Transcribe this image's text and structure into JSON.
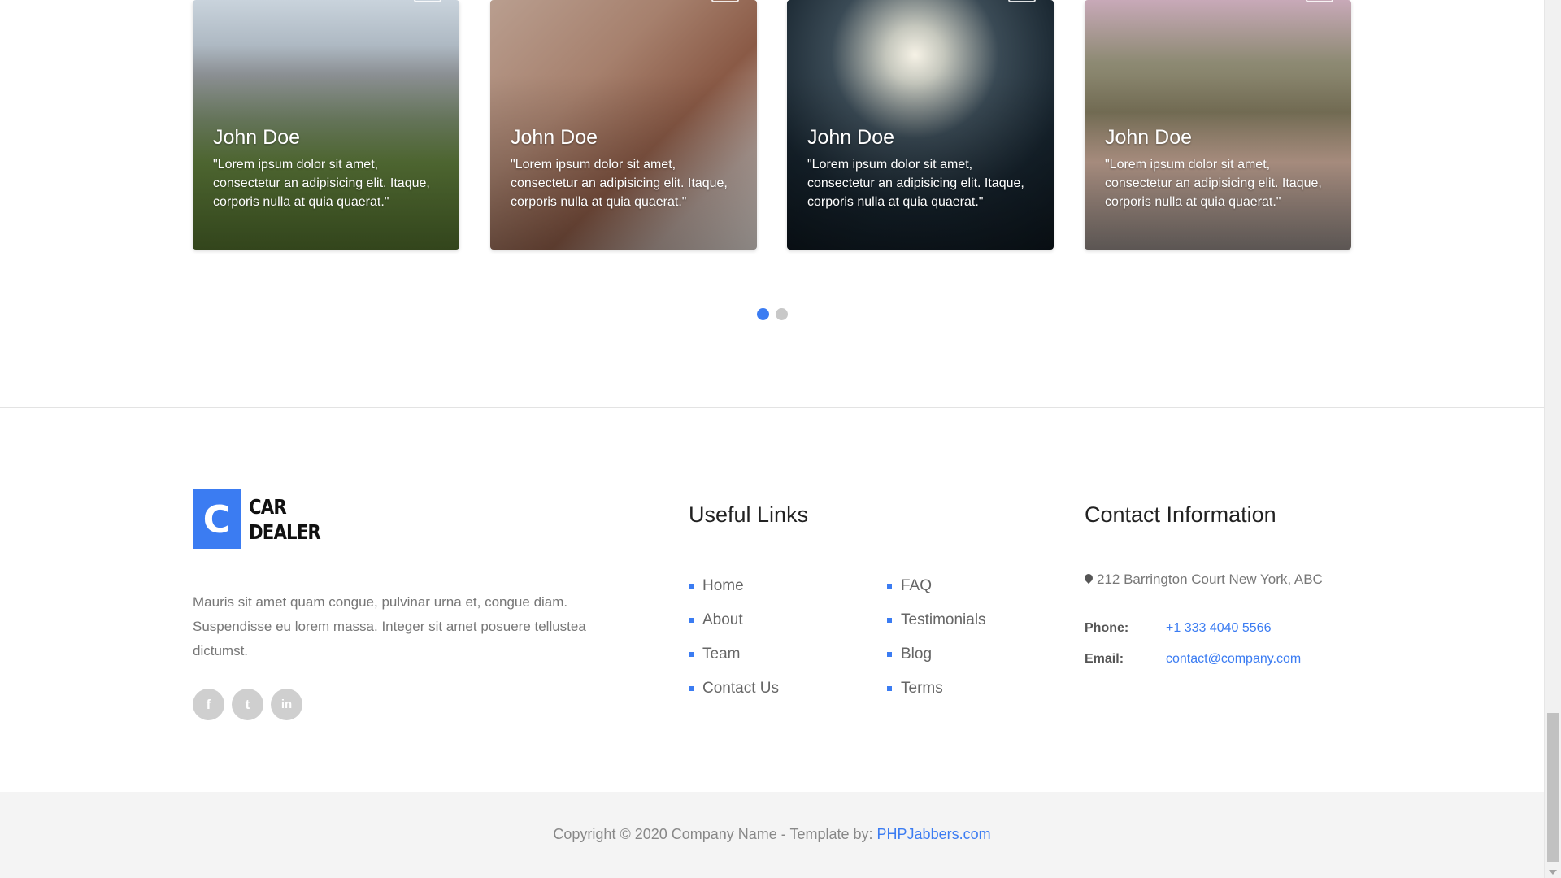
{
  "testimonials": [
    {
      "name": "John Doe",
      "quote": "\"Lorem ipsum dolor sit amet, consectetur an adipisicing elit. Itaque, corporis nulla at quia quaerat.\"",
      "image": "mountain-hiker-photo"
    },
    {
      "name": "John Doe",
      "quote": "\"Lorem ipsum dolor sit amet, consectetur an adipisicing elit. Itaque, corporis nulla at quia quaerat.\"",
      "image": "woman-sunglasses-photo"
    },
    {
      "name": "John Doe",
      "quote": "\"Lorem ipsum dolor sit amet, consectetur an adipisicing elit. Itaque, corporis nulla at quia quaerat.\"",
      "image": "fireworks-photo"
    },
    {
      "name": "John Doe",
      "quote": "\"Lorem ipsum dolor sit amet, consectetur an adipisicing elit. Itaque, corporis nulla at quia quaerat.\"",
      "image": "party-balloons-photo"
    }
  ],
  "carousel": {
    "pages": 2,
    "active_page": 1
  },
  "footer": {
    "logo": {
      "letter": "C",
      "line1": "CAR",
      "line2": "DEALER"
    },
    "about": "Mauris sit amet quam congue, pulvinar urna et, congue diam. Suspendisse eu lorem massa. Integer sit amet posuere tellustea dictumst.",
    "socials": [
      "facebook-icon",
      "twitter-icon",
      "linkedin-icon"
    ],
    "social_glyphs": [
      "f",
      "t",
      "in"
    ],
    "useful_links_title": "Useful Links",
    "links_col1": [
      "Home",
      "About",
      "Team",
      "Contact Us"
    ],
    "links_col2": [
      "FAQ",
      "Testimonials",
      "Blog",
      "Terms"
    ],
    "contact_title": "Contact Information",
    "address": "212 Barrington Court New York, ABC",
    "phone_label": "Phone:",
    "phone": "+1 333 4040 5566",
    "email_label": "Email:",
    "email": "contact@company.com",
    "copyright_prefix": "Copyright © 2020 Company Name - Template by: ",
    "copyright_link": "PHPJabbers.com"
  },
  "colors": {
    "accent": "#3b7cf2",
    "bottom_bar": "#f4f4f4"
  }
}
